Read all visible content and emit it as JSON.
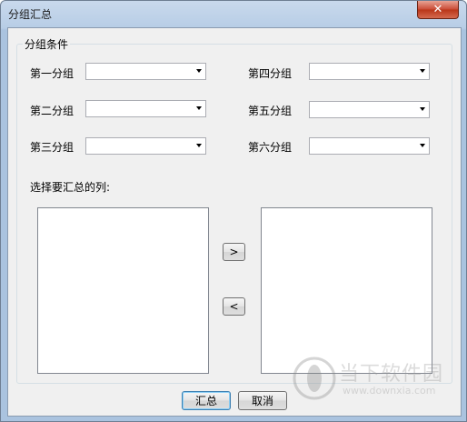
{
  "window": {
    "title": "分组汇总",
    "close_symbol": "✕"
  },
  "groupbox": {
    "legend": "分组条件",
    "fields": [
      {
        "label": "第一分组",
        "value": ""
      },
      {
        "label": "第二分组",
        "value": ""
      },
      {
        "label": "第三分组",
        "value": ""
      },
      {
        "label": "第四分组",
        "value": ""
      },
      {
        "label": "第五分组",
        "value": ""
      },
      {
        "label": "第六分组",
        "value": ""
      }
    ],
    "columns_label": "选择要汇总的列:",
    "move_right_label": ">",
    "move_left_label": "<"
  },
  "footer": {
    "ok_label": "汇总",
    "cancel_label": "取消"
  },
  "watermark": {
    "site_name": "当下软件园",
    "site_url": "www.downxia.com"
  }
}
